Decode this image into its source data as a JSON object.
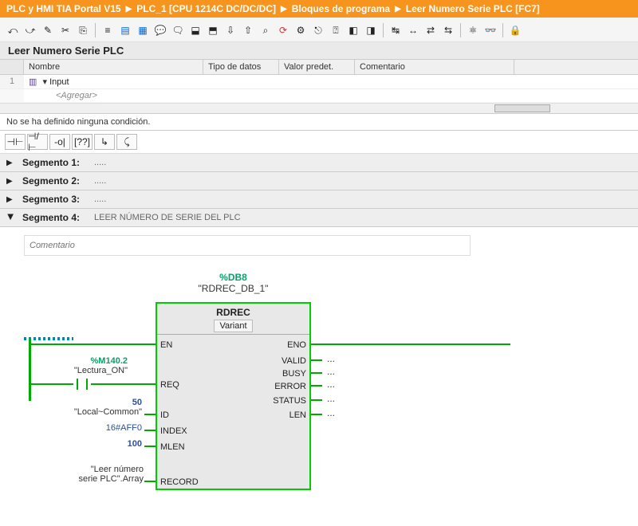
{
  "breadcrumb": {
    "p0": "PLC y HMI TIA Portal V15",
    "p1": "PLC_1 [CPU 1214C DC/DC/DC]",
    "p2": "Bloques de programa",
    "p3": "Leer Numero Serie PLC [FC7]"
  },
  "fn_title": "Leer Numero Serie PLC",
  "table": {
    "hdr_name": "Nombre",
    "hdr_type": "Tipo de datos",
    "hdr_default": "Valor predet.",
    "hdr_comment": "Comentario",
    "row1_num": "1",
    "row1_name": "Input",
    "row2_add": "<Agregar>"
  },
  "cond": "No se ha definido ninguna condición.",
  "ladder_icons": {
    "i0": "⊣⊢",
    "i1": "⊣/⊢",
    "i2": "-o|",
    "i3": "[??]",
    "i4": "↳",
    "i5": "⤹"
  },
  "seg": {
    "s1": "Segmento 1:",
    "s2": "Segmento 2:",
    "s3": "Segmento 3:",
    "s4": "Segmento 4:",
    "s4_desc": "LEER NÚMERO DE SERIE DEL PLC",
    "dots": "....."
  },
  "comment_ph": "Comentario",
  "block": {
    "db": "%DB8",
    "db_name": "\"RDREC_DB_1\"",
    "type": "RDREC",
    "variant": "Variant",
    "EN": "EN",
    "REQ": "REQ",
    "ID": "ID",
    "INDEX": "INDEX",
    "MLEN": "MLEN",
    "RECORD": "RECORD",
    "ENO": "ENO",
    "VALID": "VALID",
    "BUSY": "BUSY",
    "ERROR": "ERROR",
    "STATUS": "STATUS",
    "LEN": "LEN"
  },
  "sig": {
    "req_addr": "%M140.2",
    "req_name": "\"Lectura_ON\"",
    "id_num": "50",
    "id_name": "\"Local~Common\"",
    "index": "16#AFF0",
    "mlen": "100",
    "record_l1": "\"Leer número",
    "record_l2": "serie PLC\".Array"
  },
  "out_dots": "...",
  "tool_tips": {
    "t0": "↶",
    "t1": "↷",
    "t2": "≣",
    "t3": "▤",
    "t4": "⎘",
    "t5": "⎌",
    "t6": "⌕",
    "t7": "⚙"
  }
}
